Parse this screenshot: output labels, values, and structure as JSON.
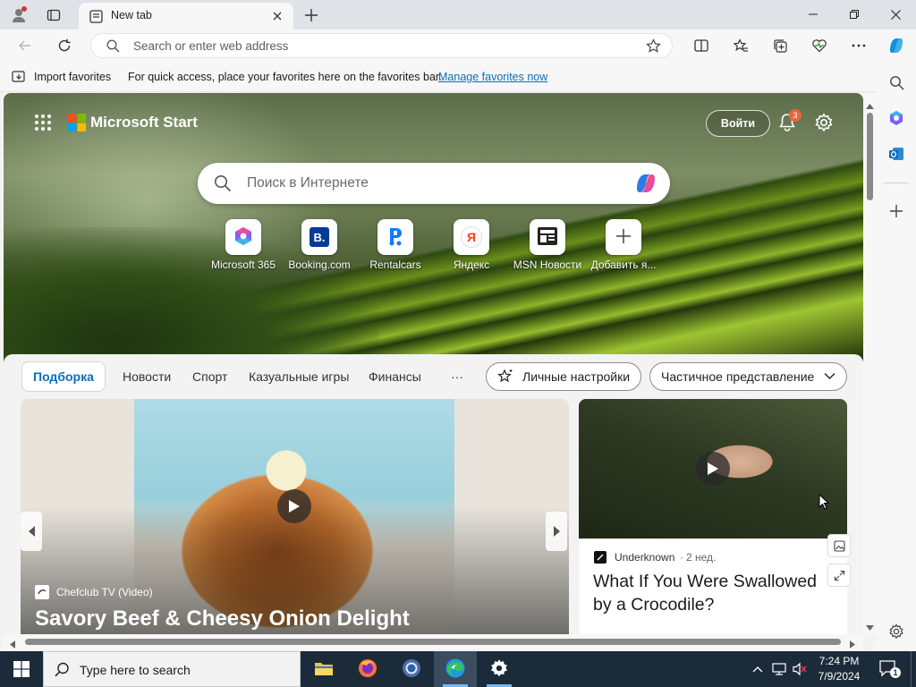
{
  "browser": {
    "tab_title": "New tab",
    "address_placeholder": "Search or enter web address",
    "favorites_bar": {
      "import_label": "Import favorites",
      "hint": "For quick access, place your favorites here on the favorites bar.",
      "manage_link": "Manage favorites now"
    }
  },
  "start": {
    "brand": "Microsoft Start",
    "login_label": "Войти",
    "notification_count": "3",
    "search_placeholder": "Поиск в Интернете",
    "quick_links": [
      {
        "label": "Microsoft 365",
        "icon": "microsoft-365-icon"
      },
      {
        "label": "Booking.com",
        "icon": "booking-icon"
      },
      {
        "label": "Rentalcars",
        "icon": "rentalcars-icon"
      },
      {
        "label": "Яндекс",
        "icon": "yandex-icon"
      },
      {
        "label": "MSN Новости",
        "icon": "msn-news-icon"
      },
      {
        "label": "Добавить я...",
        "icon": "add-icon"
      }
    ],
    "nav": {
      "tabs": [
        "Подборка",
        "Новости",
        "Спорт",
        "Казуальные игры",
        "Финансы"
      ],
      "more": "···",
      "personalize_label": "Личные настройки",
      "view_label": "Частичное представление"
    },
    "cards": [
      {
        "source": "Chefclub TV (Video)",
        "title": "Savory Beef & Cheesy Onion Delight"
      },
      {
        "source": "Underknown",
        "age": "2 нед.",
        "title": "What If You Were Swallowed by a Crocodile?"
      }
    ]
  },
  "taskbar": {
    "search_placeholder": "Type here to search",
    "time": "7:24 PM",
    "date": "7/9/2024",
    "notification_count": "1"
  },
  "colors": {
    "accent": "#0f6cbd",
    "taskbar": "#1c2b3a",
    "badge": "#e8663c"
  }
}
